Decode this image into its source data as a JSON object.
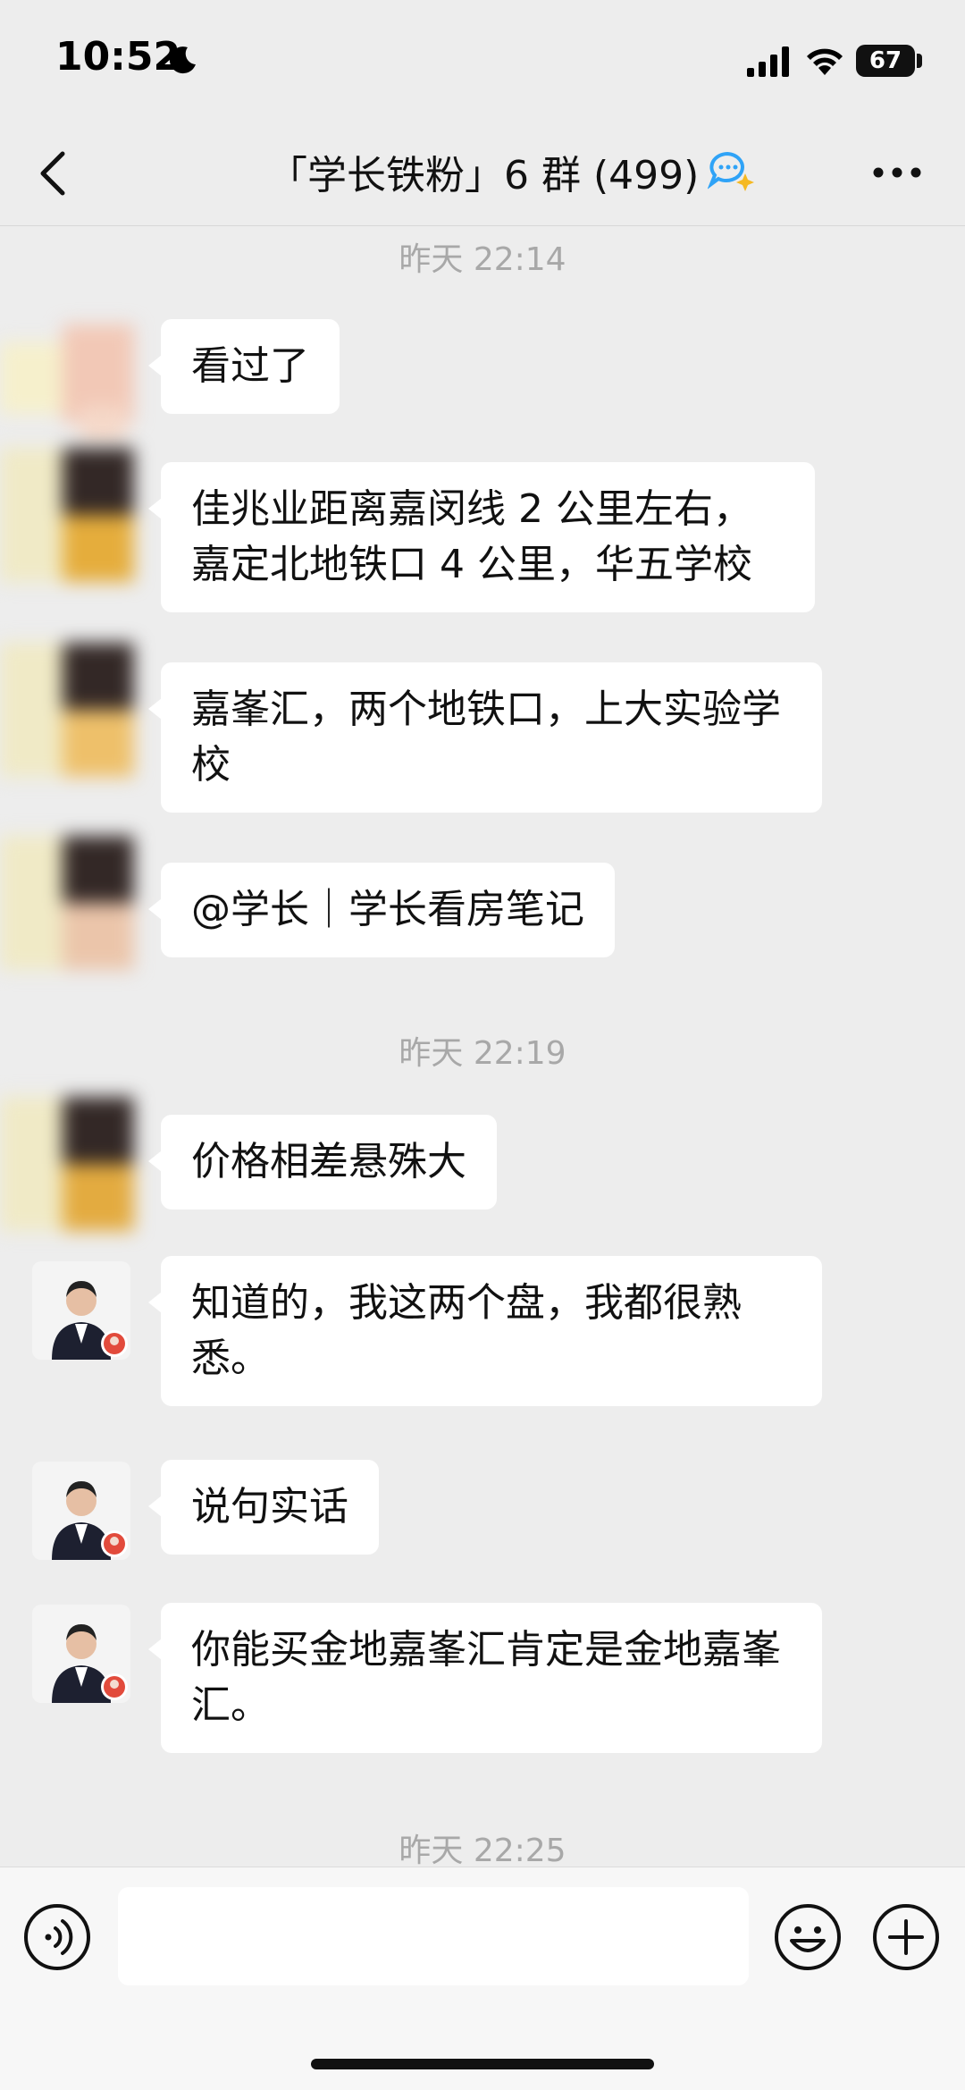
{
  "status_bar": {
    "time": "10:52",
    "battery": "67"
  },
  "nav": {
    "title": "「学长铁粉」6 群 (499)"
  },
  "chat": {
    "timestamps": [
      "昨天 22:14",
      "昨天 22:19",
      "昨天 22:25"
    ],
    "messages": [
      {
        "text": "看过了"
      },
      {
        "text": "佳兆业距离嘉闵线 2 公里左右，嘉定北地铁口 4 公里，华五学校"
      },
      {
        "text": "嘉峯汇，两个地铁口，上大实验学校"
      },
      {
        "text": "@学长｜学长看房笔记"
      },
      {
        "text": "价格相差悬殊大"
      },
      {
        "text": "知道的，我这两个盘，我都很熟悉。"
      },
      {
        "text": "说句实话"
      },
      {
        "text": "你能买金地嘉峯汇肯定是金地嘉峯汇。"
      }
    ]
  },
  "input": {
    "placeholder": ""
  },
  "colors": {
    "background": "#ededed",
    "bubble": "#ffffff",
    "timestamp": "#a8a8a8"
  }
}
